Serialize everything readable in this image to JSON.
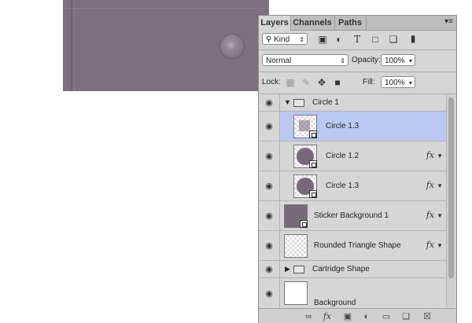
{
  "panel": {
    "tabs": [
      {
        "label": "Layers",
        "active": true
      },
      {
        "label": "Channels",
        "active": false
      },
      {
        "label": "Paths",
        "active": false
      }
    ],
    "menu_icon": "panel-menu-icon",
    "filter": {
      "kind_label": "Kind"
    },
    "blend_mode": "Normal",
    "opacity_label": "Opacity:",
    "opacity_value": "100%",
    "lock_label": "Lock:",
    "fill_label": "Fill:",
    "fill_value": "100%"
  },
  "layers": [
    {
      "name": "Circle 1",
      "type": "group",
      "expanded": true
    },
    {
      "name": "Circle 1.3",
      "type": "shape",
      "selected": true,
      "fx": false
    },
    {
      "name": "Circle 1.2",
      "type": "shape",
      "selected": false,
      "fx": true,
      "fx_label": "fx"
    },
    {
      "name": "Circle 1.3",
      "type": "shape",
      "selected": false,
      "fx": true,
      "fx_label": "fx"
    },
    {
      "name": "Sticker Background 1",
      "type": "shape",
      "selected": false,
      "fx": true,
      "fx_label": "fx"
    },
    {
      "name": "Rounded Triangle Shape",
      "type": "shape",
      "selected": false,
      "fx": true,
      "fx_label": "fx"
    },
    {
      "name": "Cartridge Shape",
      "type": "group",
      "expanded": false
    },
    {
      "name": "Background",
      "type": "pixel"
    }
  ],
  "colors": {
    "canvas": "#7d6f7e",
    "selection": "#b9c8f2",
    "circle_fill": "#77697a"
  }
}
